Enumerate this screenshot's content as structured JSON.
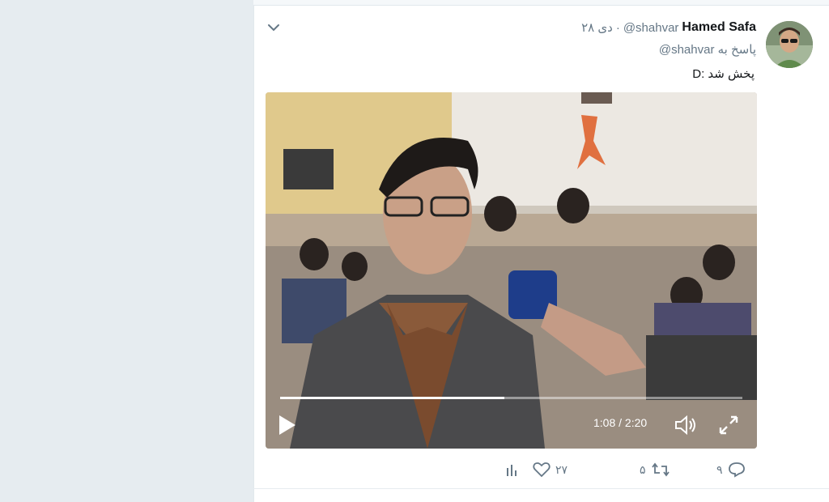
{
  "tweet": {
    "author_name": "Hamed Safa",
    "handle": "@shahvar",
    "separator": "·",
    "time": "۲۸ دی",
    "reply_prefix": "پاسخ به",
    "reply_to": "@shahvar",
    "text": "پخش شد :D"
  },
  "video": {
    "time_readout": "1:08 / 2:20",
    "progress": 0.485
  },
  "actions": {
    "reply_count": "۹",
    "retweet_count": "۵",
    "like_count": "۲۷"
  },
  "icons": {
    "caret": "chevron-down-icon",
    "play": "play-icon",
    "volume": "volume-icon",
    "fullscreen": "fullscreen-icon",
    "reply": "reply-icon",
    "retweet": "retweet-icon",
    "like": "heart-icon",
    "analytics": "analytics-icon"
  },
  "colors": {
    "background": "#e6ecf0",
    "card": "#ffffff",
    "secondary_text": "#657786",
    "primary_text": "#14171a"
  }
}
